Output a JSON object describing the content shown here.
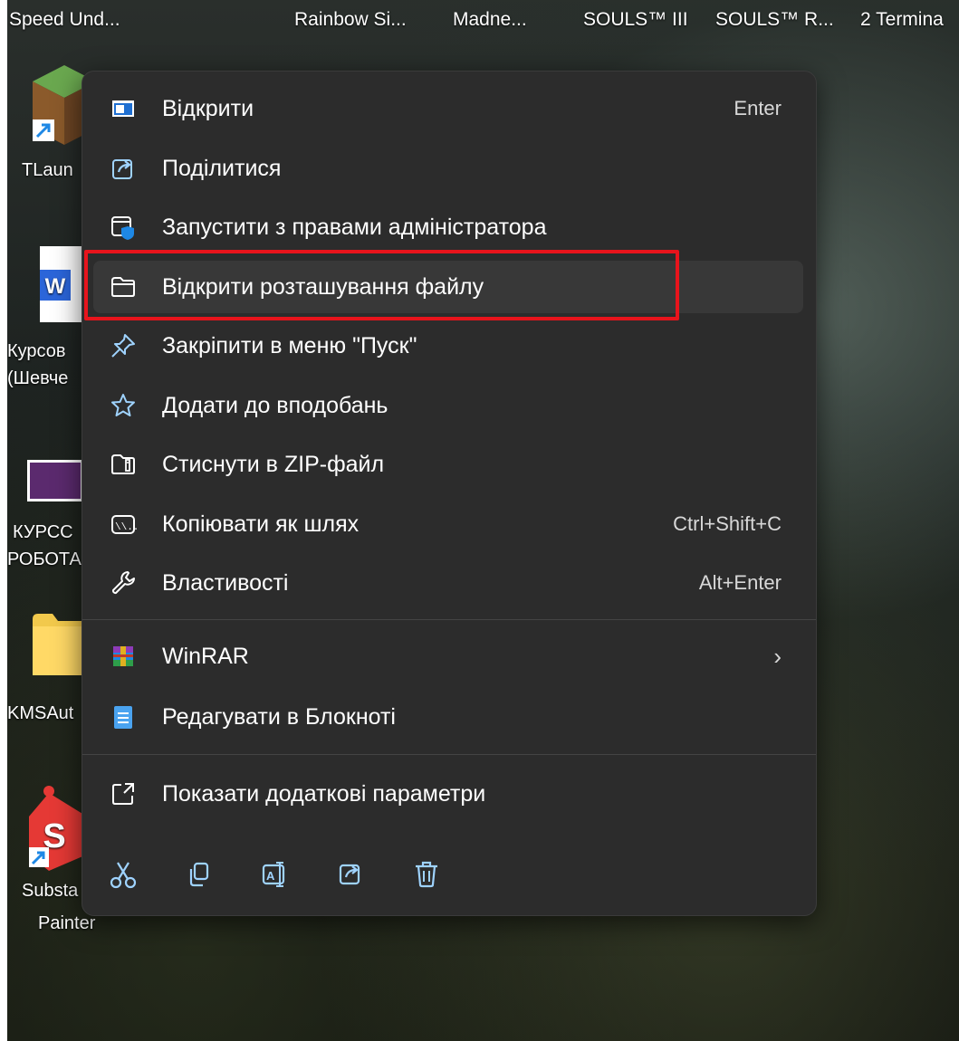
{
  "taskbar": {
    "titles": [
      "Speed Und...",
      "Rainbow Si...",
      "Madne...",
      "SOULS™ III",
      "SOULS™ R...",
      "2 Termina"
    ]
  },
  "desktop": {
    "labels": [
      "TLaun",
      "Курсов",
      "(Шевче",
      "КУРСС",
      "РОБОТА",
      "KMSAut",
      "Substa",
      "Painter"
    ]
  },
  "menu": {
    "items": [
      {
        "label": "Відкрити",
        "shortcut": "Enter",
        "icon": "open-window-icon"
      },
      {
        "label": "Поділитися",
        "shortcut": "",
        "icon": "share-icon"
      },
      {
        "label": "Запустити з правами адміністратора",
        "shortcut": "",
        "icon": "admin-shield-icon"
      },
      {
        "label": "Відкрити розташування файлу",
        "shortcut": "",
        "icon": "folder-icon"
      },
      {
        "label": "Закріпити в меню \"Пуск\"",
        "shortcut": "",
        "icon": "pin-icon"
      },
      {
        "label": "Додати до вподобань",
        "shortcut": "",
        "icon": "star-icon"
      },
      {
        "label": "Стиснути в ZIP-файл",
        "shortcut": "",
        "icon": "zip-folder-icon"
      },
      {
        "label": "Копіювати як шлях",
        "shortcut": "Ctrl+Shift+C",
        "icon": "copy-path-icon"
      },
      {
        "label": "Властивості",
        "shortcut": "Alt+Enter",
        "icon": "wrench-icon"
      },
      {
        "label": "WinRAR",
        "shortcut": "",
        "icon": "winrar-icon"
      },
      {
        "label": "Редагувати в Блокноті",
        "shortcut": "",
        "icon": "notepad-icon"
      },
      {
        "label": "Показати додаткові параметри",
        "shortcut": "",
        "icon": "more-options-icon"
      }
    ],
    "submenu_arrow": "›",
    "bottom_actions": [
      "cut-icon",
      "copy-icon",
      "rename-icon",
      "share-icon",
      "delete-icon"
    ]
  },
  "colors": {
    "menu_bg": "#2c2c2c",
    "hover_bg": "#383838",
    "accent": "#60cdff",
    "highlight_border": "#e8141c"
  }
}
